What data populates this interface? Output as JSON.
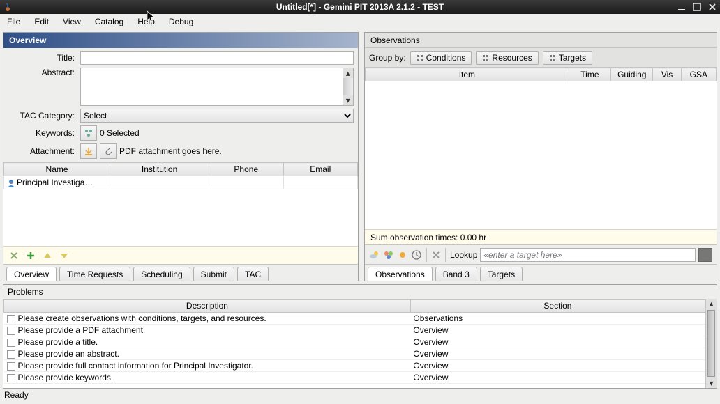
{
  "window": {
    "title": "Untitled[*] - Gemini PIT 2013A 2.1.2 - TEST"
  },
  "menu": [
    "File",
    "Edit",
    "View",
    "Catalog",
    "Help",
    "Debug"
  ],
  "overview": {
    "header": "Overview",
    "labels": {
      "title": "Title:",
      "abstract": "Abstract:",
      "tac": "TAC Category:",
      "keywords": "Keywords:",
      "attachment": "Attachment:"
    },
    "values": {
      "title": "",
      "abstract": "",
      "tac": "Select",
      "keywords": "0 Selected",
      "attachment": "PDF attachment goes here."
    },
    "investigators": {
      "cols": [
        "Name",
        "Institution",
        "Phone",
        "Email"
      ],
      "rows": [
        {
          "name": "Principal Investiga…",
          "institution": "",
          "phone": "",
          "email": ""
        }
      ]
    },
    "tabs": [
      "Overview",
      "Time Requests",
      "Scheduling",
      "Submit",
      "TAC"
    ]
  },
  "observations": {
    "header": "Observations",
    "group_by": "Group by:",
    "groups": [
      "Conditions",
      "Resources",
      "Targets"
    ],
    "cols": [
      "Item",
      "Time",
      "Guiding",
      "Vis",
      "GSA"
    ],
    "sum": "Sum observation times: 0.00 hr",
    "lookup_label": "Lookup",
    "lookup_placeholder": "«enter a target here»",
    "tabs": [
      "Observations",
      "Band 3",
      "Targets"
    ]
  },
  "problems": {
    "header": "Problems",
    "cols": [
      "Description",
      "Section"
    ],
    "rows": [
      {
        "desc": "Please create observations with conditions, targets, and resources.",
        "sec": "Observations"
      },
      {
        "desc": "Please provide a PDF attachment.",
        "sec": "Overview"
      },
      {
        "desc": "Please provide a title.",
        "sec": "Overview"
      },
      {
        "desc": "Please provide an abstract.",
        "sec": "Overview"
      },
      {
        "desc": "Please provide full contact information for Principal Investigator.",
        "sec": "Overview"
      },
      {
        "desc": "Please provide keywords.",
        "sec": "Overview"
      }
    ]
  },
  "status": "Ready"
}
